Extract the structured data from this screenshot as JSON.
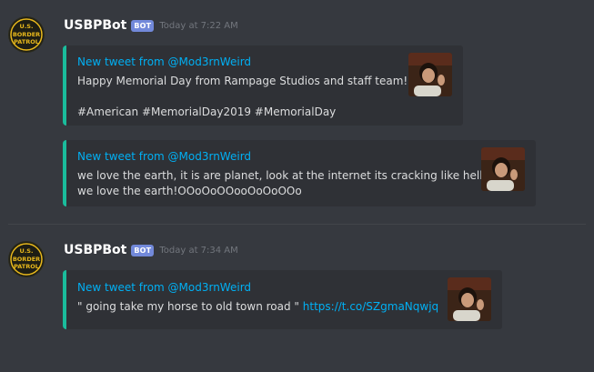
{
  "messages": [
    {
      "username": "USBPBot",
      "bot_tag": "BOT",
      "timestamp": "Today at 7:22 AM",
      "avatar_text": [
        "U.S.",
        "BORDER",
        "PATROL"
      ],
      "embeds": [
        {
          "title": "New tweet from @Mod3rnWeird",
          "lines": [
            "Happy Memorial Day from Rampage Studios and staff team!",
            "",
            "#American #MemorialDay2019 #MemorialDay"
          ]
        },
        {
          "title": "New tweet from @Mod3rnWeird",
          "lines": [
            "we love the earth, it is are planet, look at the internet its cracking like hell,",
            "we love the earth!OOoOoOOooOoOoOOo"
          ]
        }
      ]
    },
    {
      "username": "USBPBot",
      "bot_tag": "BOT",
      "timestamp": "Today at 7:34 AM",
      "avatar_text": [
        "U.S.",
        "BORDER",
        "PATROL"
      ],
      "embeds": [
        {
          "title": "New tweet from @Mod3rnWeird",
          "text": "\" going take my horse to old town road \"",
          "link": "https://t.co/SZgmaNqwjq"
        }
      ]
    }
  ],
  "colors": {
    "background": "#36393f",
    "embed_background": "#2f3136",
    "embed_accent": "#1abc9c",
    "link": "#00b0f4",
    "bot_tag": "#7289da"
  }
}
